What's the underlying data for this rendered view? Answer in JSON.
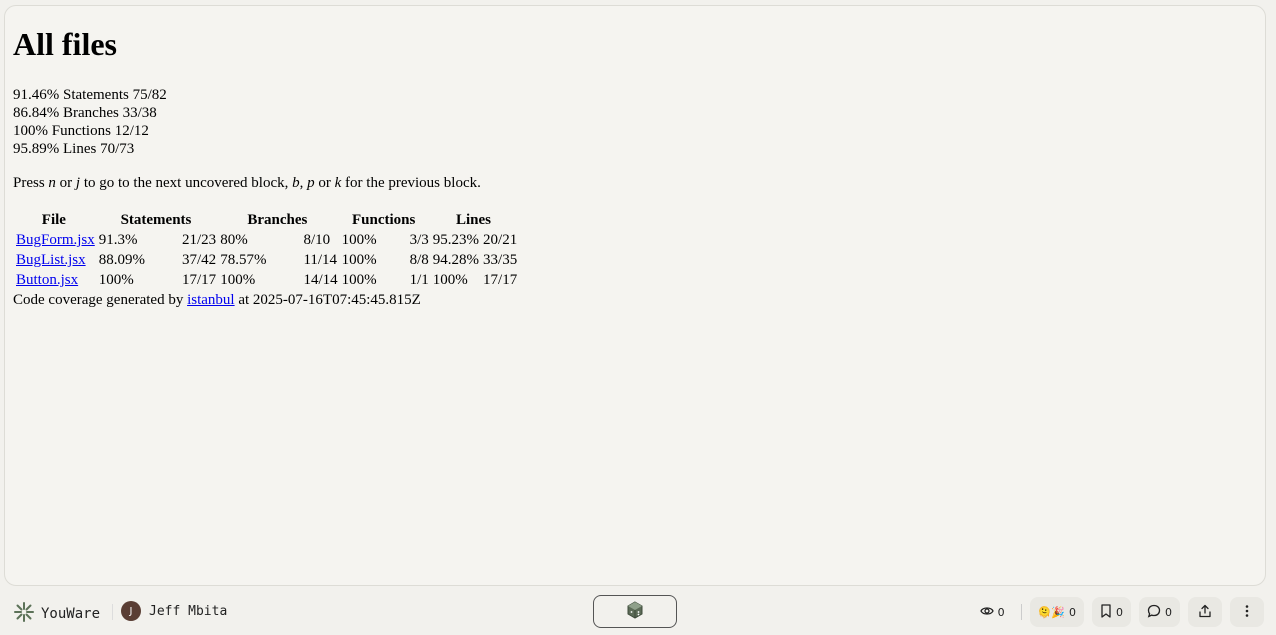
{
  "report": {
    "title": "All files",
    "summary": [
      {
        "pct": "91.46%",
        "label": "Statements",
        "frac": "75/82"
      },
      {
        "pct": "86.84%",
        "label": "Branches",
        "frac": "33/38"
      },
      {
        "pct": "100%",
        "label": "Functions",
        "frac": "12/12"
      },
      {
        "pct": "95.89%",
        "label": "Lines",
        "frac": "70/73"
      }
    ],
    "hint": {
      "press": "Press",
      "k1": "n",
      "or1": "or",
      "k2": "j",
      "mid": "to go to the next uncovered block,",
      "k3": "b",
      "comma": ",",
      "k4": "p",
      "or2": "or",
      "k5": "k",
      "end": "for the previous block."
    },
    "table": {
      "headers": [
        "File",
        "Statements",
        "Branches",
        "Functions",
        "Lines"
      ],
      "rows": [
        {
          "file": "BugForm.jsx",
          "s_pct": "91.3%",
          "s_frac": "21/23",
          "b_pct": "80%",
          "b_frac": "8/10",
          "f_pct": "100%",
          "f_frac": "3/3",
          "l_pct": "95.23%",
          "l_frac": "20/21"
        },
        {
          "file": "BugList.jsx",
          "s_pct": "88.09%",
          "s_frac": "37/42",
          "b_pct": "78.57%",
          "b_frac": "11/14",
          "f_pct": "100%",
          "f_frac": "8/8",
          "l_pct": "94.28%",
          "l_frac": "33/35"
        },
        {
          "file": "Button.jsx",
          "s_pct": "100%",
          "s_frac": "17/17",
          "b_pct": "100%",
          "b_frac": "14/14",
          "f_pct": "100%",
          "f_frac": "1/1",
          "l_pct": "100%",
          "l_frac": "17/17"
        }
      ]
    },
    "footer": {
      "prefix": "Code coverage generated by",
      "link": "istanbul",
      "suffix": "at 2025-07-16T07:45:45.815Z"
    }
  },
  "bottom_bar": {
    "brand": "YouWare",
    "user_initial": "J",
    "user_name": "Jeff Mbita",
    "views": "0",
    "reactions": "0",
    "bookmarks": "0",
    "comments": "0",
    "reaction_emojis": "🫠🎉"
  }
}
